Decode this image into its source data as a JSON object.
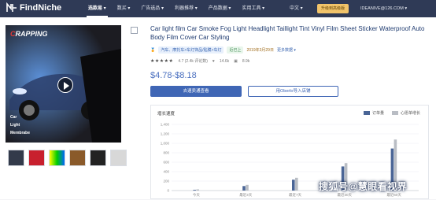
{
  "header": {
    "logo_text": "FindNiche",
    "nav": [
      "选款易 ▾",
      "数买 ▾",
      "广告选品 ▾",
      "利器推荐 ▾",
      "产品数据 ▾",
      "实用工具 ▾"
    ],
    "language": "中文 ▾",
    "upgrade_label": "升级到高级版",
    "email": "IDEANIVE@126.COM ▾"
  },
  "product": {
    "title": "Car light film Car Smoke Fog Light Headlight Taillight Tint Vinyl Film Sheet Sticker Waterproof Auto Body Film Cover Car Styling",
    "image_brand_prefix": "C",
    "image_brand_rest": "RAPPING",
    "image_labels": [
      "Car",
      "Light",
      "Membrabe"
    ],
    "category_tag": "汽车、摩托车>车灯饰品/贴膜>车灯",
    "status_tag": "近已上",
    "date": "2019年3月29日",
    "view_link": "更多数据 ▾",
    "rating_stars": "★★★★★",
    "rating_text": "4.7 (2.4k 评论数)",
    "likes": "14.6k",
    "orders": "8.9k",
    "price": "$4.78-$8.18",
    "primary_button": "去速卖通查看",
    "secondary_button": "用Oberlo导入店铺"
  },
  "chart_title": "增长速度",
  "watermark": "搜狐号@慧眼看视界",
  "chart_data": {
    "type": "bar",
    "title": "增长速度",
    "categories": [
      "今天",
      "最近3天",
      "最近7天",
      "最近30天",
      "最近60天"
    ],
    "series": [
      {
        "name": "订单量",
        "values": [
          15,
          95,
          230,
          510,
          890
        ],
        "color": "#4a6596"
      },
      {
        "name": "心愿单增长",
        "values": [
          25,
          120,
          270,
          580,
          1080
        ],
        "color": "#b9bdc4"
      }
    ],
    "yticks": [
      0,
      200,
      400,
      600,
      800,
      1000,
      1200,
      1400
    ],
    "ylim": [
      0,
      1400
    ],
    "grid": true,
    "legend_position": "top-right"
  }
}
